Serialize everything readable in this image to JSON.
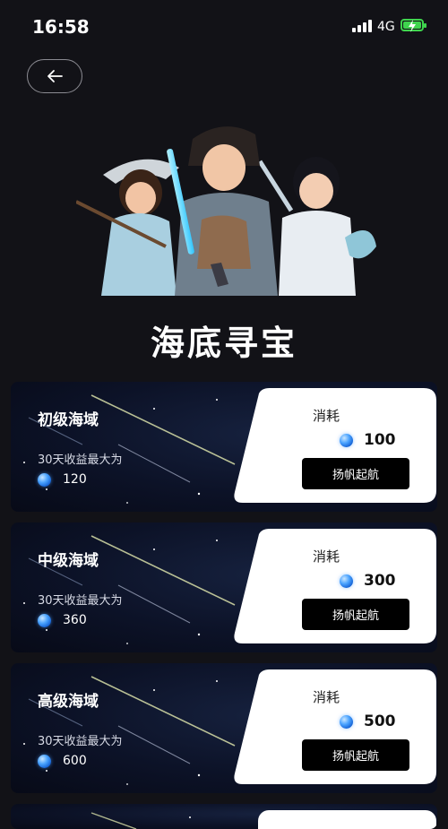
{
  "status": {
    "time": "16:58",
    "network": "4G"
  },
  "header": {
    "back_icon": "arrow-left-icon"
  },
  "hero": {
    "image": "three-anime-warriors-illustration"
  },
  "page_title": "海底寻宝",
  "cards": [
    {
      "title": "初级海域",
      "subtitle": "30天收益最大为",
      "reward": "120",
      "cost_label": "消耗",
      "cost": "100",
      "button": "扬帆起航"
    },
    {
      "title": "中级海域",
      "subtitle": "30天收益最大为",
      "reward": "360",
      "cost_label": "消耗",
      "cost": "300",
      "button": "扬帆起航"
    },
    {
      "title": "高级海域",
      "subtitle": "30天收益最大为",
      "reward": "600",
      "cost_label": "消耗",
      "cost": "500",
      "button": "扬帆起航"
    }
  ],
  "colors": {
    "background": "#121217",
    "card": "#0c1227",
    "gem": "#4aa3ff",
    "battery": "#3fd44e"
  }
}
